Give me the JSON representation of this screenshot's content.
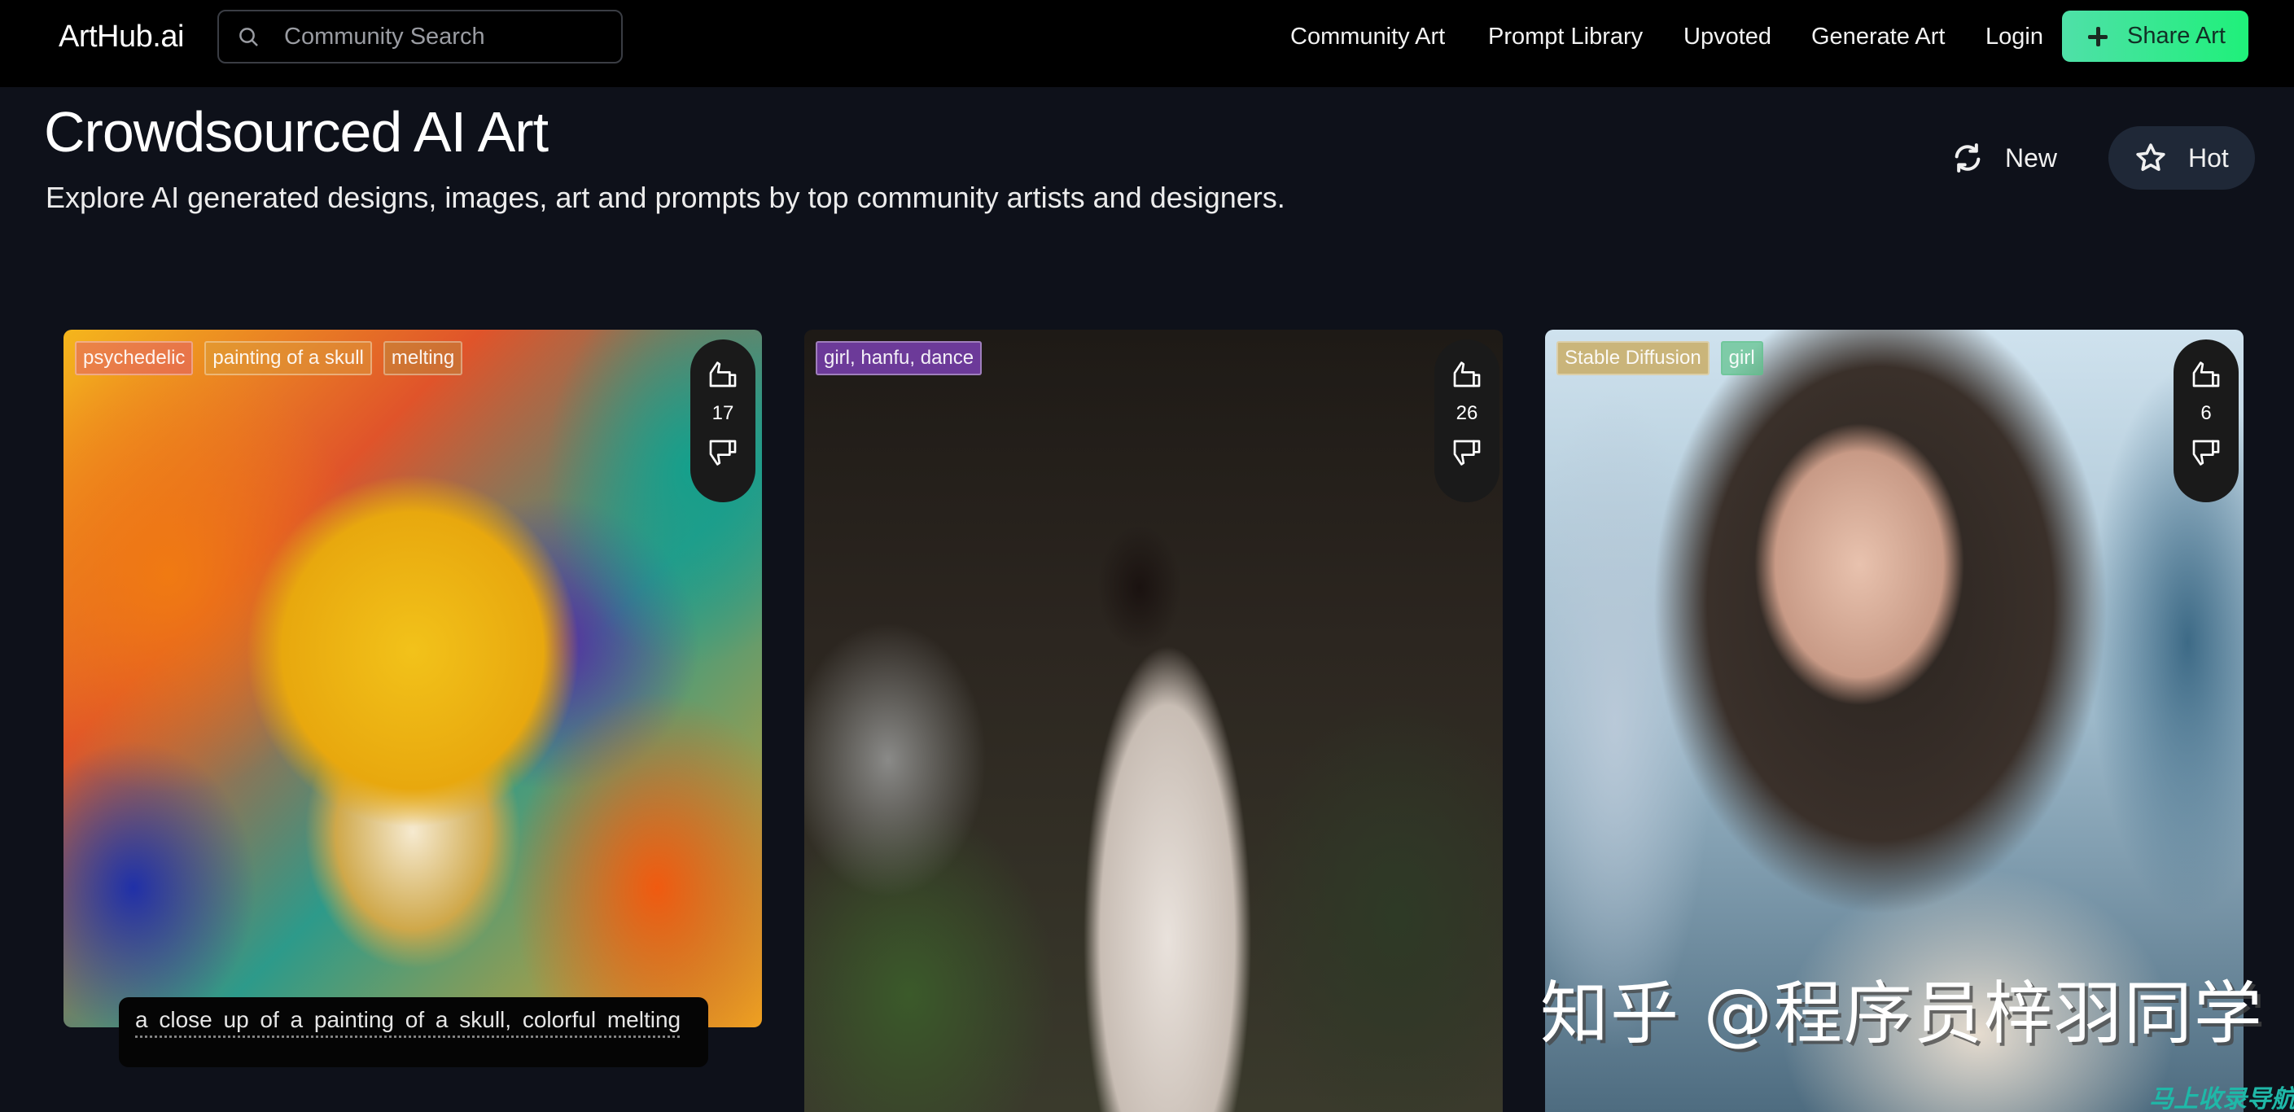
{
  "nav": {
    "logo": "ArtHub.ai",
    "search_placeholder": "Community Search",
    "search_value": "",
    "links": [
      "Community Art",
      "Prompt Library",
      "Upvoted",
      "Generate Art",
      "Login"
    ],
    "share_button": "Share Art",
    "accent_gradient": [
      "#4fe0a8",
      "#1ff07a"
    ]
  },
  "header": {
    "title": "Crowdsourced AI Art",
    "subtitle": "Explore AI generated designs, images, art and prompts by top community artists and designers."
  },
  "sort": {
    "options": [
      {
        "label": "New",
        "icon": "refresh-icon",
        "active": false
      },
      {
        "label": "Hot",
        "icon": "star-icon",
        "active": true
      }
    ]
  },
  "cards": [
    {
      "tags": [
        {
          "label": "psychedelic",
          "color": "#e0507a"
        },
        {
          "label": "painting of a skull",
          "color": "#d9a040"
        },
        {
          "label": "melting",
          "color": "#b89040"
        }
      ],
      "votes": "17",
      "caption": "a close up of a painting of a skull, colorful melting"
    },
    {
      "tags": [
        {
          "label": "girl,  hanfu,  dance",
          "color": "#7a3fb0"
        }
      ],
      "votes": "26",
      "caption": ""
    },
    {
      "tags": [
        {
          "label": "Stable Diffusion",
          "color": "#c9a24a"
        },
        {
          "label": "girl",
          "color": "#5cc28a"
        }
      ],
      "votes": "6",
      "caption": ""
    }
  ],
  "watermark": {
    "main": "知乎 @程序员梓羽同学",
    "corner": "马上收录导航"
  }
}
